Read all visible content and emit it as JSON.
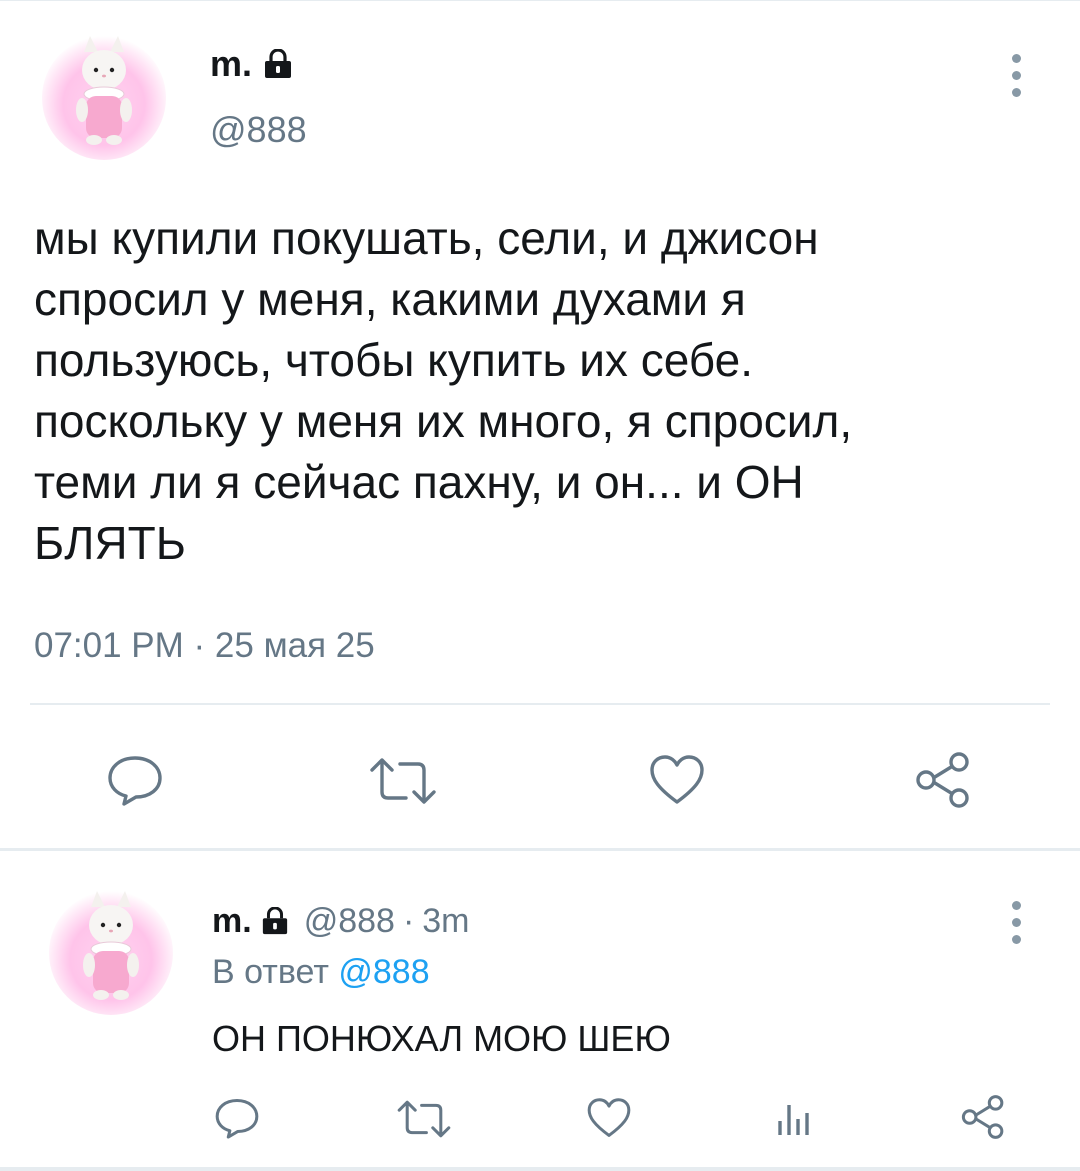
{
  "main_tweet": {
    "display_name": "m.",
    "handle": "@888",
    "text_lines": [
      "мы купили покушать, сели, и джисон",
      "спросил у меня, какими духами я",
      "пользуюсь, чтобы купить их себе.",
      "поскольку у меня их много, я спросил,",
      "теми ли я сейчас пахну, и он... и ОН",
      "БЛЯТЬ"
    ],
    "timestamp": "07:01 PM · 25 мая 25",
    "actions": [
      "reply-icon",
      "retweet-icon",
      "like-icon",
      "share-icon"
    ]
  },
  "reply_tweet": {
    "display_name": "m.",
    "handle": "@888",
    "separator": "·",
    "time_ago": "3m",
    "reply_to_label": "В ответ",
    "reply_to_handle": "@888",
    "text": "ОН ПОНЮХАЛ МОЮ ШЕЮ",
    "actions": [
      "reply-icon",
      "retweet-icon",
      "like-icon",
      "analytics-icon",
      "share-icon"
    ]
  },
  "colors": {
    "text": "#14171a",
    "secondary": "#657786",
    "accent": "#1da1f2",
    "divider": "#e6ecf0",
    "icon": "#657786"
  }
}
